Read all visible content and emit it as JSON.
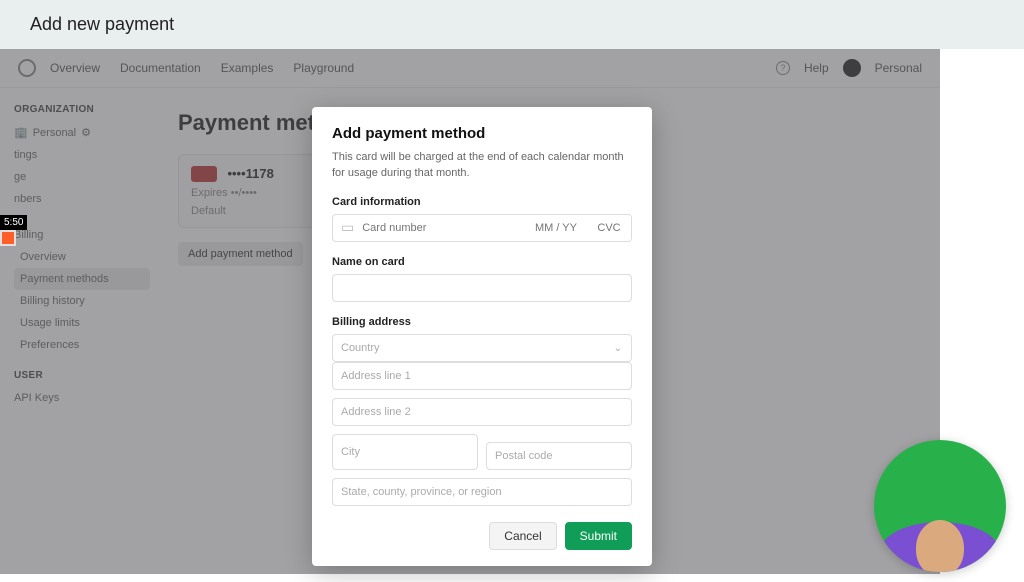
{
  "outer": {
    "title": "Add new payment"
  },
  "nav": {
    "links": [
      "Overview",
      "Documentation",
      "Examples",
      "Playground"
    ],
    "help": "Help",
    "personal": "Personal"
  },
  "sidebar": {
    "org_head": "ORGANIZATION",
    "personal": "Personal",
    "partial_items": [
      "tings",
      "ge",
      "nbers"
    ],
    "billing_head": "Billing",
    "billing_items": [
      "Overview",
      "Payment methods",
      "Billing history",
      "Usage limits",
      "Preferences"
    ],
    "user_head": "USER",
    "user_items": [
      "API Keys"
    ]
  },
  "main": {
    "heading": "Payment methods",
    "card_masked": "••••1178",
    "card_expires": "Expires ••/••••",
    "default_label": "Default",
    "add_btn": "Add payment method"
  },
  "modal": {
    "title": "Add payment method",
    "desc": "This card will be charged at the end of each calendar month for usage during that month.",
    "card_info_label": "Card information",
    "card_number_ph": "Card number",
    "mmyy_ph": "MM / YY",
    "cvc_ph": "CVC",
    "name_label": "Name on card",
    "billing_label": "Billing address",
    "country_ph": "Country",
    "addr1_ph": "Address line 1",
    "addr2_ph": "Address line 2",
    "city_ph": "City",
    "postal_ph": "Postal code",
    "state_ph": "State, county, province, or region",
    "cancel": "Cancel",
    "submit": "Submit"
  },
  "timer": "5:50"
}
